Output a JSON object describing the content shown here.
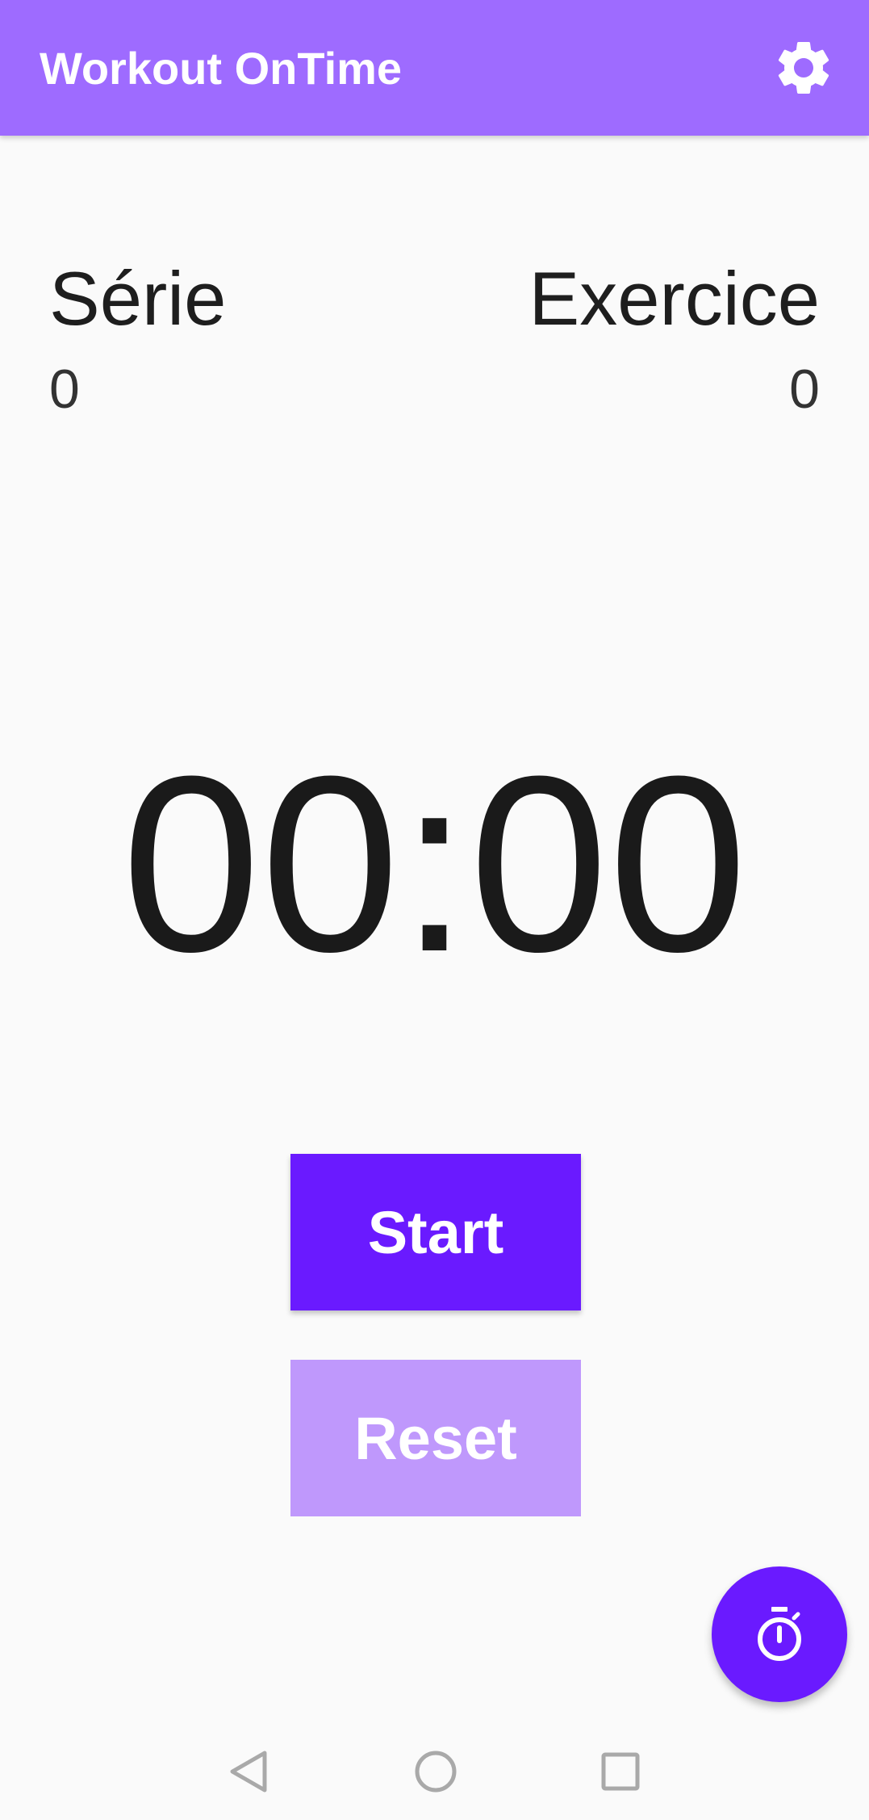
{
  "app_bar": {
    "title": "Workout OnTime",
    "settings_icon": "gear-icon"
  },
  "counters": {
    "serie": {
      "label": "Série",
      "value": "0"
    },
    "exercice": {
      "label": "Exercice",
      "value": "0"
    }
  },
  "timer": {
    "display": "00:00"
  },
  "buttons": {
    "start_label": "Start",
    "reset_label": "Reset"
  },
  "fab": {
    "icon": "stopwatch-icon"
  },
  "nav_bar": {
    "back_icon": "back-triangle-icon",
    "home_icon": "home-circle-icon",
    "recents_icon": "recents-square-icon"
  },
  "colors": {
    "app_bar": "#9e6bff",
    "primary": "#6a1aff",
    "reset_button": "#bf98fc",
    "background": "#fafafa"
  }
}
